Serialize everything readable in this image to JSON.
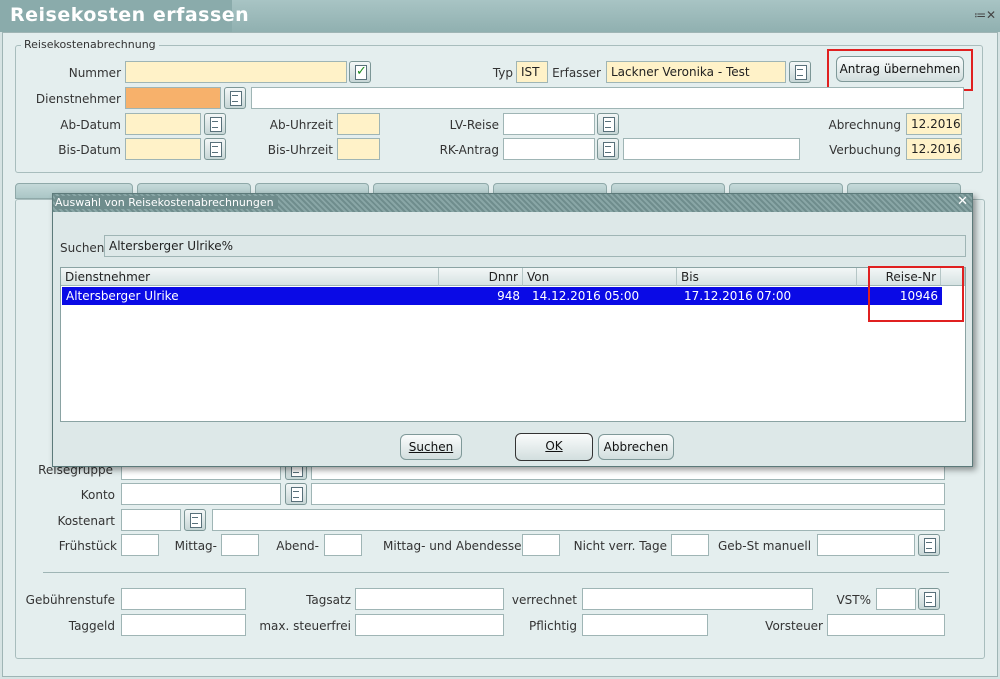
{
  "window": {
    "title": "Reisekosten erfassen",
    "controls": "≔✕"
  },
  "form": {
    "group_label": "Reisekostenabrechnung",
    "nummer_label": "Nummer",
    "nummer_value": "",
    "typ_label": "Typ",
    "typ_value": "IST",
    "erfasser_label": "Erfasser",
    "erfasser_value": "Lackner Veronika - Test",
    "antrag_button": "Antrag übernehmen",
    "dienstnehmer_label": "Dienstnehmer",
    "ab_datum_label": "Ab-Datum",
    "ab_uhrzeit_label": "Ab-Uhrzeit",
    "lv_reise_label": "LV-Reise",
    "abrechnung_label": "Abrechnung",
    "abrechnung_value": "12.2016",
    "bis_datum_label": "Bis-Datum",
    "bis_uhrzeit_label": "Bis-Uhrzeit",
    "rk_antrag_label": "RK-Antrag",
    "verbuchung_label": "Verbuchung",
    "verbuchung_value": "12.2016"
  },
  "lower": {
    "reisegruppe_label": "Reisegruppe",
    "konto_label": "Konto",
    "kostenart_label": "Kostenart",
    "fruehstueck_label": "Frühstück",
    "mittag_label": "Mittag-",
    "abend_label": "Abend-",
    "mittag_abend_label": "Mittag- und Abendessen",
    "nicht_verr_label": "Nicht verr. Tage",
    "geb_st_label": "Geb-St manuell",
    "gebuehrenstufe_label": "Gebührenstufe",
    "tagsatz_label": "Tagsatz",
    "verrechnet_label": "verrechnet",
    "vst_label": "VST%",
    "taggeld_label": "Taggeld",
    "max_steuerfrei_label": "max. steuerfrei",
    "pflichtig_label": "Pflichtig",
    "vorsteuer_label": "Vorsteuer"
  },
  "dialog": {
    "title": "Auswahl von Reisekostenabrechnungen",
    "search_label": "Suchen",
    "search_value": "Altersberger Ulrike%",
    "columns": [
      "Dienstnehmer",
      "Dnnr",
      "Von",
      "Bis",
      "Reise-Nr"
    ],
    "rows": [
      {
        "dienstnehmer": "Altersberger Ulrike",
        "dnnr": "948",
        "von": "14.12.2016  05:00",
        "bis": "17.12.2016  07:00",
        "reise_nr": "10946"
      }
    ],
    "btn_suchen": "Suchen",
    "btn_ok": "OK",
    "btn_abbrechen": "Abbrechen"
  }
}
